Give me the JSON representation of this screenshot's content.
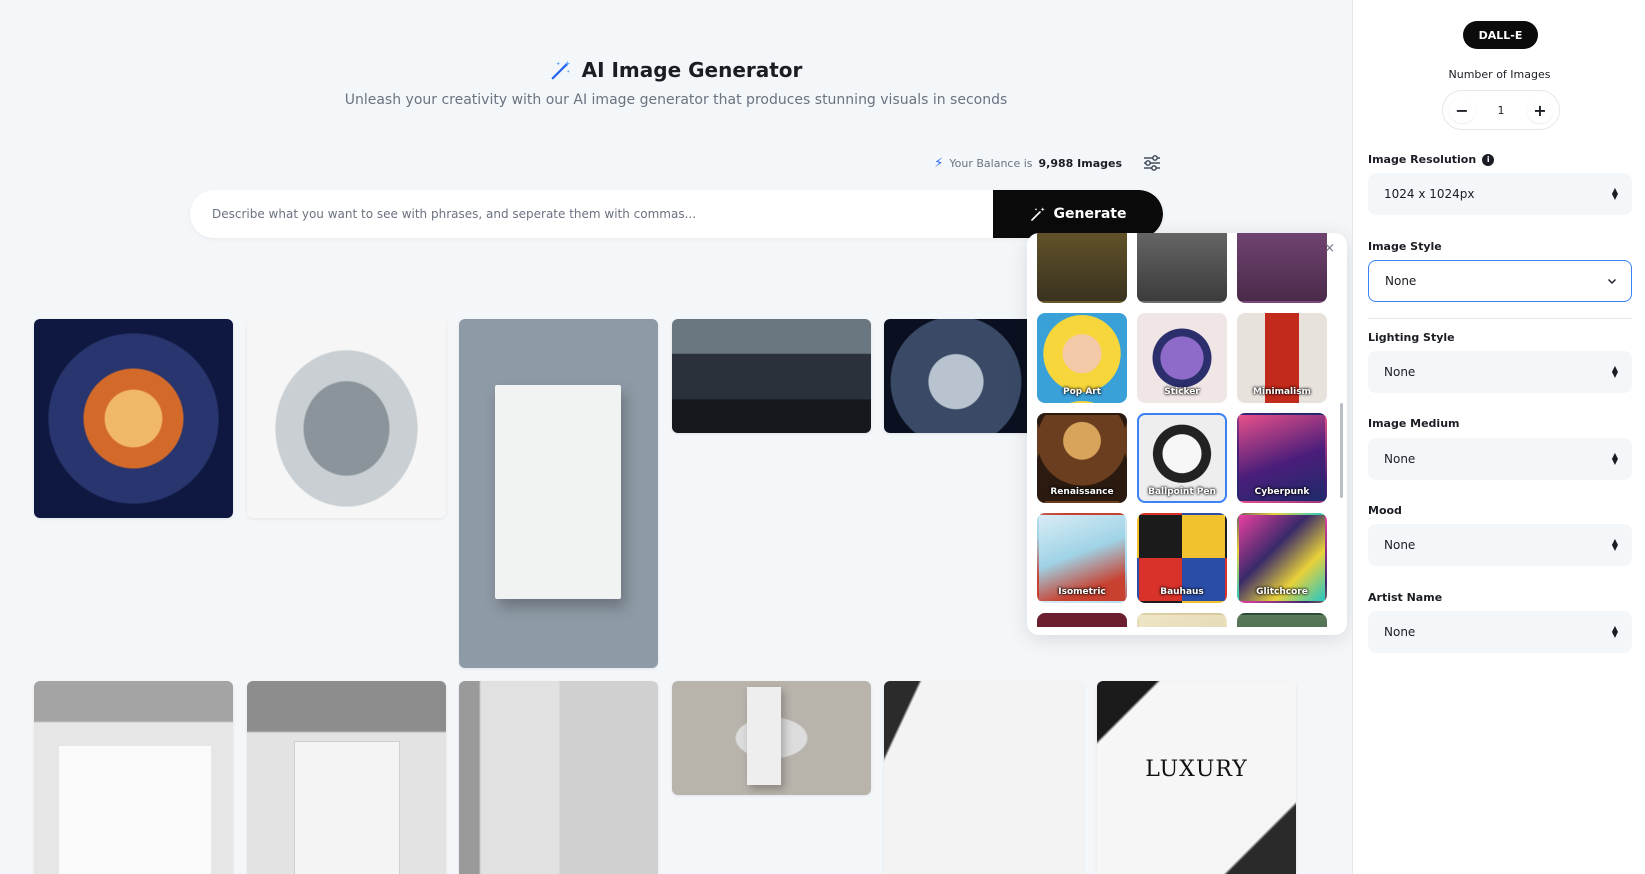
{
  "header": {
    "title": "AI Image Generator",
    "subtitle": "Unleash your creativity with our AI image generator that produces stunning visuals in seconds"
  },
  "balance": {
    "prefix": "Your Balance is",
    "value": "9,988 Images"
  },
  "prompt": {
    "placeholder": "Describe what you want to see with phrases, and seperate them with commas...",
    "generate_label": "Generate"
  },
  "style_popup": {
    "close_glyph": "×",
    "styles": [
      {
        "label": "",
        "bg": "linear-gradient(180deg,#6b5a2a,#3a3320)"
      },
      {
        "label": "",
        "bg": "linear-gradient(180deg,#6f6f6f,#3c3c3c)"
      },
      {
        "label": "",
        "bg": "linear-gradient(180deg,#7a4a7a,#4a2a4a)"
      },
      {
        "label": "Pop Art",
        "bg": "radial-gradient(circle at 50% 45%,#f4c9a8 0 30%,#f6d63a 31% 60%,#3aa0d8 61%)"
      },
      {
        "label": "Sticker",
        "bg": "radial-gradient(circle at 50% 50%,#8e6ac9 0 35%,#2b2f6b 36% 48%,#f1e6e6 49%)"
      },
      {
        "label": "Minimalism",
        "bg": "linear-gradient(90deg,#e8e2dc 0 30%,#c22a1c 30% 70%,#e8e2dc 70%)"
      },
      {
        "label": "Renaissance",
        "bg": "radial-gradient(circle at 50% 30%,#d8a35a 0 25%,#6a3e1e 26% 60%,#2a1a10 61%)"
      },
      {
        "label": "Ballpoint Pen",
        "bg": "radial-gradient(circle at 50% 45%,#f7f7f7 0 30%,#222 31% 45%,#eeeeee 46%)"
      },
      {
        "label": "Cyberpunk",
        "bg": "linear-gradient(160deg,#e8508a,#4a1e7a 55%,#1e2a6a)"
      },
      {
        "label": "Isometric",
        "bg": "linear-gradient(160deg,#d9ecf5,#9fd3e6 45%,#c8402f 80%)"
      },
      {
        "label": "Bauhaus",
        "bg": "conic-gradient(#f2c12e 0 25%,#2a4ea8 25% 50%,#d8322a 50% 75%,#1b1b1b 75%)"
      },
      {
        "label": "Glitchcore",
        "bg": "linear-gradient(135deg,#e83fa0,#3a2a6a 40%,#e8d13a 70%,#22c7c7)"
      },
      {
        "label": "",
        "bg": "radial-gradient(circle at 50% 50%,#e4a9c0 0 25%,#6b1e2e 26%)"
      },
      {
        "label": "",
        "bg": "linear-gradient(160deg,#efe6c8,#d7c89b)"
      },
      {
        "label": "",
        "bg": "linear-gradient(180deg,#5a7a5a,#2a4a3a)"
      }
    ]
  },
  "gallery": [
    {
      "id": "thumb-fish-ramen",
      "bg": "radial-gradient(circle at 50% 50%,#f2b86a 0 20%,#d46a2a 21% 35%,#28356e 36% 60%,#0f1840 61%)"
    },
    {
      "id": "thumb-cat-fish",
      "bg": "radial-gradient(ellipse at 50% 55%,#8a949a 0 30%,#c9cfd2 31% 50%,#f6f6f6 51%)"
    },
    {
      "id": "thumb-abstract-spheres-tall",
      "bg": "radial-gradient(ellipse at 50% 50%,#e9ebec 0 35%,#b4bdc6 36% 40%,#8e9aa6 41%)"
    },
    {
      "id": "thumb-city-beam",
      "bg": "linear-gradient(180deg,#6a7680 0 30%,#2a313a 31% 70%,#15191e 71%)"
    },
    {
      "id": "thumb-mech-space",
      "bg": "radial-gradient(circle at 45% 55%,#b8c3cf 0 25%,#3a4a66 26% 60%,#0b1020 61%)"
    },
    {
      "id": "thumb-abstract-gray-1",
      "bg": "linear-gradient(180deg,#a4a4a4 0 20%,#e6e6e6 21%)"
    },
    {
      "id": "thumb-abstract-gray-2",
      "bg": "linear-gradient(180deg,#8d8d8d 0 25%,#e3e3e3 26%)"
    },
    {
      "id": "thumb-abstract-gray-3",
      "bg": "linear-gradient(90deg,#9a9a9a 0 10%,#e1e1e1 11% 50%,#d0d0d0 51%)"
    },
    {
      "id": "thumb-abstract-arch",
      "bg": "radial-gradient(ellipse at 50% 50%,#dcdcdc 0 25%,#b8b3ab 26%)"
    },
    {
      "id": "thumb-white-panel",
      "bg": "linear-gradient(115deg,#2b2b2b 0 12%,#f3f3f3 13%)"
    },
    {
      "id": "thumb-luxury",
      "bg": "linear-gradient(135deg,#1b1b1b 0 15%,#f6f6f6 16% 80%,#2a2a2a 81%)"
    }
  ],
  "luxury_text": "LUXURY",
  "sidebar": {
    "model": "DALL-E",
    "num_images_label": "Number of Images",
    "num_images_value": "1",
    "minus": "−",
    "plus": "+",
    "resolution_label": "Image Resolution",
    "resolution_value": "1024 x 1024px",
    "style_label": "Image Style",
    "style_value": "None",
    "lighting_label": "Lighting Style",
    "lighting_value": "None",
    "medium_label": "Image Medium",
    "medium_value": "None",
    "mood_label": "Mood",
    "mood_value": "None",
    "artist_label": "Artist Name",
    "artist_value": "None",
    "info_glyph": "i"
  },
  "colors": {
    "accent": "#3b82f6",
    "bolt": "#2563eb",
    "dark": "#0b0b0b"
  }
}
